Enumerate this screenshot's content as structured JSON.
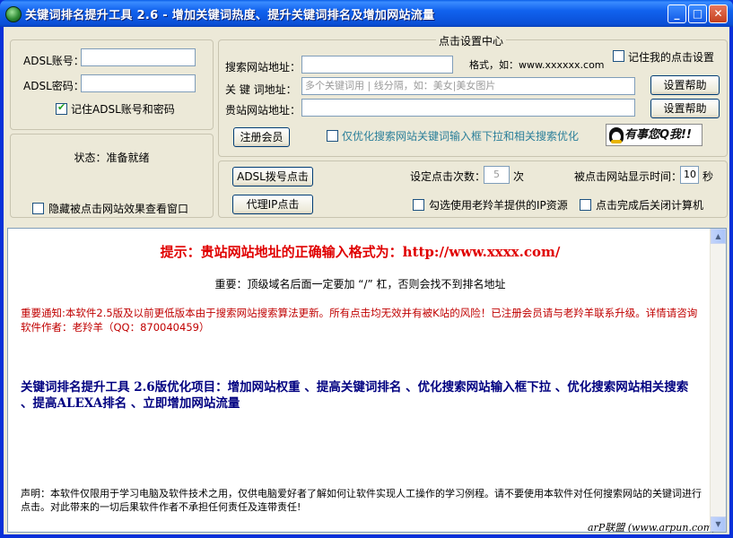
{
  "window": {
    "title": "关键词排名提升工具 2.6 - 增加关键词热度、提升关键词排名及增加网站流量",
    "min_label": "_",
    "max_label": "□",
    "close_label": "✕"
  },
  "adsl": {
    "account_label": "ADSL账号：",
    "account_value": "",
    "password_label": "ADSL密码：",
    "password_value": "",
    "remember_label": "记住ADSL账号和密码",
    "remember_checked": true
  },
  "status": {
    "text": "状态：准备就绪",
    "hide_window_label": "隐藏被点击网站效果查看窗口"
  },
  "click_settings": {
    "group_title": "点击设置中心",
    "search_site_label": "搜索网站地址：",
    "search_site_value": "",
    "format_hint": "格式，如：www.xxxxxx.com",
    "remember_click_label": "记住我的点击设置",
    "keyword_label": "关 键 词地址：",
    "keyword_placeholder": "多个关键词用 | 线分隔，如：美女|美女图片",
    "help_button_1": "设置帮助",
    "your_site_label": "贵站网站地址：",
    "your_site_value": "",
    "help_button_2": "设置帮助",
    "register_button": "注册会员",
    "dropdown_only_label": "仅优化搜索网站关键词输入框下拉和相关搜索优化",
    "qq_label": "有事您Q我!!"
  },
  "actions": {
    "adsl_dial_button": "ADSL拨号点击",
    "proxy_button": "代理IP点击",
    "click_count_label": "设定点击次数：",
    "click_count_value": "5",
    "click_count_unit": "次",
    "display_time_label": "被点击网站显示时间：",
    "display_time_value": "10",
    "display_time_unit": "秒",
    "use_ip_label": "勾选使用老羚羊提供的IP资源",
    "shutdown_label": "点击完成后关闭计算机"
  },
  "content": {
    "tip": "提示：贵站网站地址的正确输入格式为：http://www.xxxx.com/",
    "important": "重要：顶级域名后面一定要加 “/” 杠，否则会找不到排名地址",
    "notice": "重要通知:本软件2.5版及以前更低版本由于搜索网站搜索算法更新。所有点击均无效并有被K站的风险！已注册会员请与老羚羊联系升级。详情请咨询软件作者：老羚羊（QQ：870040459）",
    "optimization": "关键词排名提升工具 2.6版优化项目：增加网站权重 、提高关键词排名 、优化搜索网站输入框下拉 、优化搜索网站相关搜索 、提高ALEXA排名 、立即增加网站流量",
    "disclaimer": "声明：本软件仅限用于学习电脑及软件技术之用，仅供电脑爱好者了解如何让软件实现人工操作的学习例程。请不要使用本软件对任何搜索网站的关键词进行点击。对此带来的一切后果软件作者不承担任何责任及连带责任!",
    "brand": "arP联盟 (www.arpun.com)"
  }
}
